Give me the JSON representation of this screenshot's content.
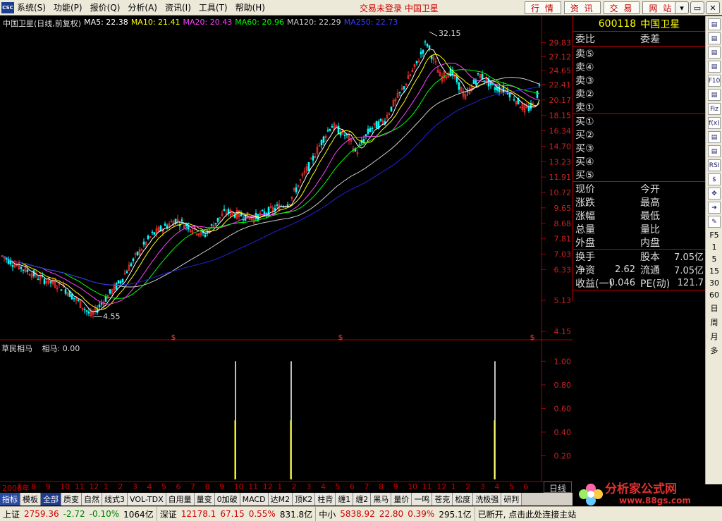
{
  "menubar": {
    "logo": "CSC",
    "items": [
      "系统(S)",
      "功能(P)",
      "报价(Q)",
      "分析(A)",
      "资讯(I)",
      "工具(T)",
      "帮助(H)"
    ],
    "status": "交易未登录  中国卫星",
    "buttons": [
      "行 情",
      "资 讯",
      "交 易",
      "网 站"
    ],
    "window_controls": [
      "▾",
      "▭",
      "✕"
    ]
  },
  "chart": {
    "stock_name": "中国卫星(日线,前复权)",
    "ma5": "MA5: 22.38",
    "ma10": "MA10: 21.41",
    "ma20": "MA20: 20.43",
    "ma60": "MA60: 20.96",
    "ma120": "MA120: 22.29",
    "ma250": "MA250: 22.73",
    "high_label": "32.15",
    "low_label": "4.55",
    "price_ticks": [
      "29.83",
      "27.12",
      "24.65",
      "22.41",
      "20.17",
      "18.15",
      "16.34",
      "14.70",
      "13.23",
      "11.91",
      "10.72",
      "9.65",
      "8.68",
      "7.81",
      "7.03",
      "6.33",
      "5.13",
      "4.15"
    ],
    "signal_marker": "$",
    "colors": {
      "up": "#ff3030",
      "down": "#00ffff",
      "ma5": "#ffffff",
      "ma10": "#ffff00",
      "ma20": "#ff40ff",
      "ma60": "#00ff00",
      "ma120": "#cccccc",
      "ma250": "#2222dd",
      "grid": "#aa0000"
    }
  },
  "indicator": {
    "name": "草民相马",
    "value_label": "相马: 0.00",
    "ticks": [
      "1.00",
      "0.80",
      "0.60",
      "0.40",
      "0.20"
    ]
  },
  "xaxis": {
    "labels": [
      "2008年",
      "7",
      "8",
      "9",
      "10",
      "11",
      "12",
      "1",
      "2",
      "3",
      "4",
      "5",
      "6",
      "7",
      "8",
      "9",
      "10",
      "11",
      "12",
      "1",
      "2",
      "3",
      "4",
      "5",
      "6",
      "7",
      "8",
      "9",
      "10",
      "11",
      "12",
      "1",
      "2",
      "3",
      "4",
      "5",
      "6"
    ],
    "period": "日线"
  },
  "quote_panel": {
    "code": "600118",
    "name": "中国卫星",
    "wei_bi": "委比",
    "wei_cha": "委差",
    "sells": [
      "卖⑤",
      "卖④",
      "卖③",
      "卖②",
      "卖①"
    ],
    "buys": [
      "买①",
      "买②",
      "买③",
      "买④",
      "买⑤"
    ],
    "fields": [
      {
        "l": "现价",
        "r": "今开"
      },
      {
        "l": "涨跌",
        "r": "最高"
      },
      {
        "l": "涨幅",
        "r": "最低"
      },
      {
        "l": "总量",
        "r": "量比"
      },
      {
        "l": "外盘",
        "r": "内盘"
      }
    ],
    "stats": [
      {
        "l": "换手",
        "v1": "",
        "r": "股本",
        "v2": "7.05亿"
      },
      {
        "l": "净资",
        "v1": "2.62",
        "r": "流通",
        "v2": "7.05亿"
      },
      {
        "l": "收益(一)",
        "v1": "0.046",
        "r": "PE(动)",
        "v2": "121.7"
      }
    ]
  },
  "right_toolbar": {
    "icons": [
      "table-icon",
      "line-chart-icon",
      "kline-icon",
      "bar-icon",
      "f10-icon",
      "bar-chart-icon",
      "fiz-icon",
      "fx-icon",
      "search-icon",
      "layout-icon",
      "rsi-icon",
      "dollar-icon",
      "move-icon",
      "arrow-icon",
      "pen-icon"
    ],
    "icon_text": [
      "",
      "",
      "",
      "",
      "F10",
      "",
      "Fiz",
      "f(x)",
      "",
      "",
      "RSI",
      "$",
      "✥",
      "➜",
      "✎"
    ],
    "periods": [
      "F5",
      "1",
      "5",
      "15",
      "30",
      "60",
      "日",
      "周",
      "月",
      "多"
    ]
  },
  "tabs": [
    "指标",
    "模板",
    "全部",
    "质变",
    "自然",
    "线式3",
    "VOL-TDX",
    "自用量",
    "量变",
    "0加破",
    "MACD",
    "达M2",
    "顶K2",
    "柱背",
    "缠1",
    "缠2",
    "黑马",
    "量价",
    "一鸣",
    "苍克",
    "松度",
    "洗极强",
    "研判"
  ],
  "statusbar": {
    "sh_label": "上证",
    "sh_index": "2759.36",
    "sh_chg": "-2.72",
    "sh_pct": "-0.10%",
    "sh_amt": "1064亿",
    "sz_label": "深证",
    "sz_index": "12178.1",
    "sz_chg": "67.15",
    "sz_pct": "0.55%",
    "sz_amt": "831.8亿",
    "zx_label": "中小",
    "zx_index": "5838.92",
    "zx_chg": "22.80",
    "zx_pct": "0.39%",
    "zx_amt": "295.1亿",
    "message": "已断开, 点击此处连接主站"
  },
  "watermark": {
    "title": "分析家公式网",
    "url": "www.88gs.com"
  }
}
